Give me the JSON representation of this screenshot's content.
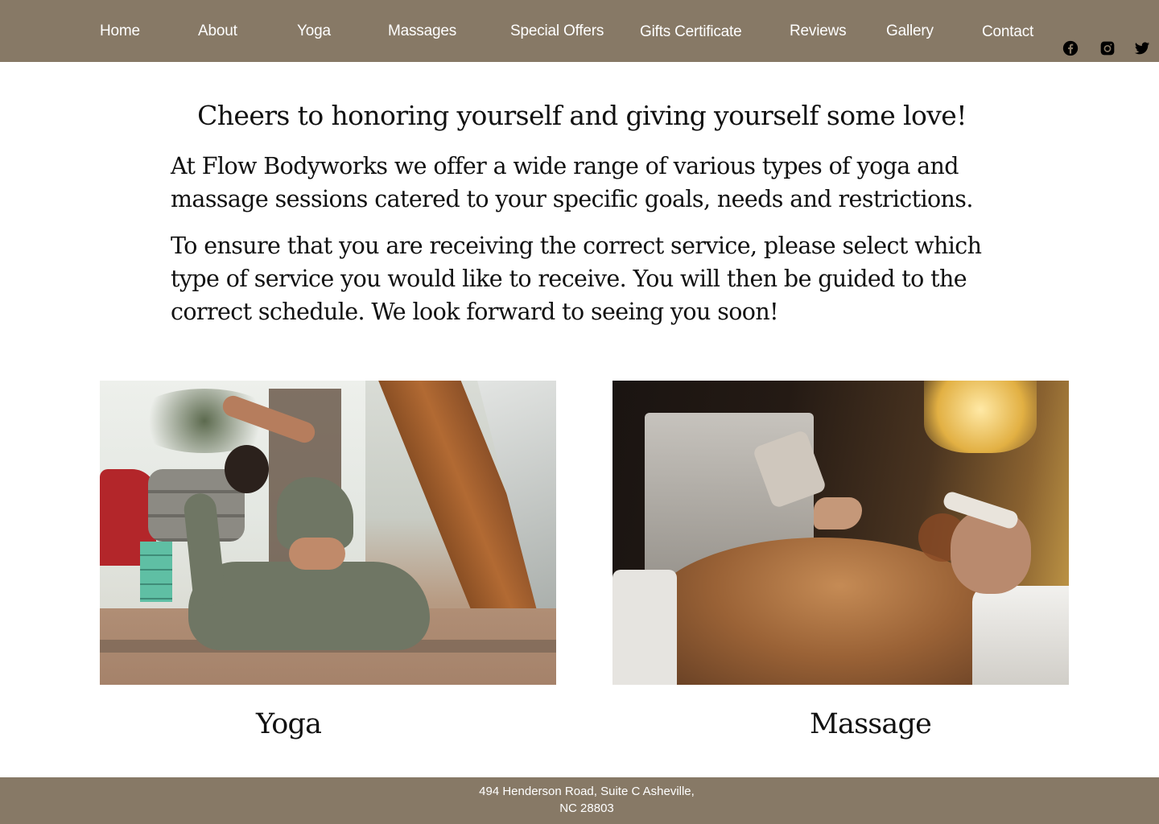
{
  "nav": {
    "items": [
      {
        "label": "Home"
      },
      {
        "label": "About"
      },
      {
        "label": "Yoga"
      },
      {
        "label": "Massages"
      },
      {
        "label": "Special Offers"
      },
      {
        "label": "Gifts Certificate"
      },
      {
        "label": "Reviews"
      },
      {
        "label": "Gallery"
      },
      {
        "label": "Contact"
      }
    ],
    "social": [
      {
        "icon": "facebook-icon"
      },
      {
        "icon": "instagram-icon"
      },
      {
        "icon": "twitter-icon"
      }
    ]
  },
  "intro": {
    "headline": "Cheers to honoring yourself and giving yourself some love!",
    "paragraph1": "At Flow Bodyworks we offer a wide range of various types of yoga and massage sessions catered to your specific goals, needs and restrictions.",
    "paragraph2": "To ensure that you are receiving the correct service, please select which type of service you would like to receive. You will then be guided to the correct schedule. We look forward to seeing you soon!"
  },
  "services": [
    {
      "label": "Yoga",
      "image_alt": "Woman in a yoga pose on a mat"
    },
    {
      "label": "Massage",
      "image_alt": "Therapist pouring massage oil on client's back"
    }
  ],
  "footer": {
    "address_line1": "494 Henderson Road, Suite C Asheville,",
    "address_line2": "NC 28803"
  },
  "colors": {
    "nav_background": "#877966",
    "footer_background": "#877966",
    "nav_text": "#ffffff",
    "body_text": "#111111"
  }
}
